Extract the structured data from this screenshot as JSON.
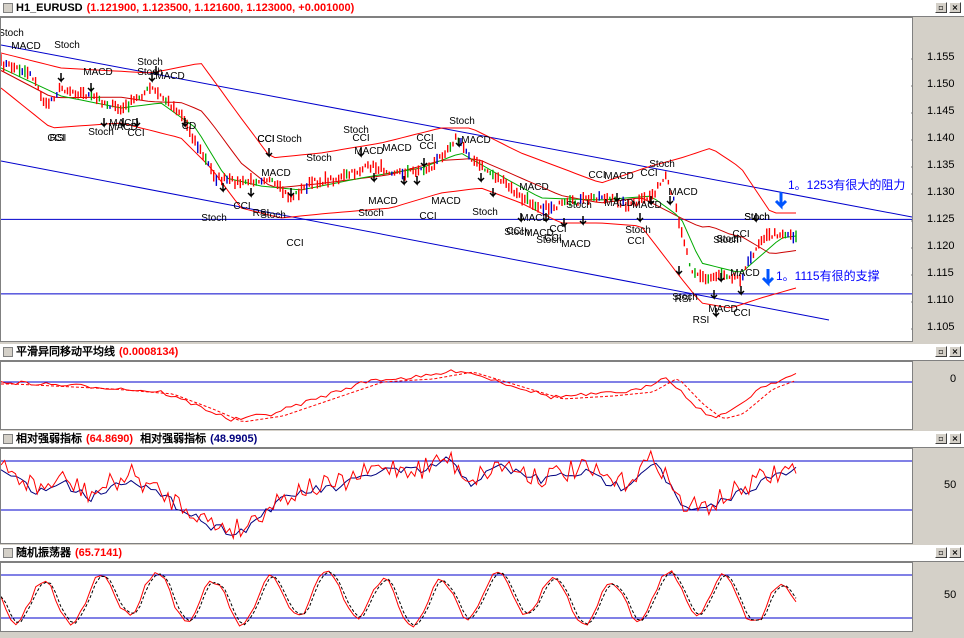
{
  "colors": {
    "price_red": "#ff0000",
    "trend_blue": "#0000cc",
    "ma_green": "#00aa00",
    "frame": "#808080",
    "annotation_blue": "#0000ff"
  },
  "main": {
    "title_symbol": "H1_EURUSD",
    "title_values": "(1.121900, 1.123500, 1.121600, 1.123000, +0.001000)",
    "y_ticks": [
      "1.155",
      "1.150",
      "1.145",
      "1.140",
      "1.135",
      "1.130",
      "1.125",
      "1.120",
      "1.115",
      "1.110",
      "1.105"
    ],
    "annotation_resistance": "1。1253有很大的阻力",
    "annotation_support": "1。1115有很的支撑"
  },
  "macd": {
    "title": "平滑异同移动平均线",
    "value": "(0.0008134)",
    "y_ticks": [
      "0"
    ]
  },
  "rsi": {
    "title1": "相对强弱指标",
    "value1": "(64.8690)",
    "title2": "相对强弱指标",
    "value2": "(48.9905)",
    "y_ticks": [
      "50"
    ]
  },
  "stoch": {
    "title": "随机振荡器",
    "value": "(65.7141)",
    "y_ticks": [
      "50"
    ]
  },
  "signals": [
    {
      "t": "Stoch"
    },
    {
      "t": "MACD"
    },
    {
      "t": "Stoch"
    },
    {
      "t": "MACD"
    },
    {
      "t": "Stoch"
    },
    {
      "t": "Stoch"
    },
    {
      "t": "MACD"
    },
    {
      "t": "CCI"
    },
    {
      "t": "RSI"
    },
    {
      "t": "MACD"
    },
    {
      "t": "Stoch"
    },
    {
      "t": "MACD"
    },
    {
      "t": "CCI"
    },
    {
      "t": "CD"
    },
    {
      "t": "CCI"
    },
    {
      "t": "CCI"
    },
    {
      "t": "Stoch"
    },
    {
      "t": "MACD"
    },
    {
      "t": "Stoch"
    },
    {
      "t": "Stoch"
    },
    {
      "t": "MACD"
    },
    {
      "t": "CCI"
    },
    {
      "t": "RSI"
    },
    {
      "t": "Stoch"
    },
    {
      "t": "CCI"
    },
    {
      "t": "Stoch"
    },
    {
      "t": "CCI"
    },
    {
      "t": "MACD"
    },
    {
      "t": "Stoch"
    },
    {
      "t": "CCI"
    },
    {
      "t": "MACD"
    },
    {
      "t": "CCI"
    },
    {
      "t": "MACD"
    },
    {
      "t": "CCI"
    },
    {
      "t": "Stoch"
    },
    {
      "t": "MACD"
    },
    {
      "t": "Stoch"
    },
    {
      "t": "CCI"
    },
    {
      "t": "MACD"
    },
    {
      "t": "Stoch"
    },
    {
      "t": "MACD"
    },
    {
      "t": "CCI"
    },
    {
      "t": "Stoch"
    },
    {
      "t": "CCI"
    },
    {
      "t": "MACD"
    },
    {
      "t": "Stoch"
    },
    {
      "t": "CCI"
    },
    {
      "t": "MACD"
    },
    {
      "t": "MACD"
    },
    {
      "t": "Stoch"
    },
    {
      "t": "CCI"
    },
    {
      "t": "MACD"
    },
    {
      "t": "Stoch"
    },
    {
      "t": "CCI"
    },
    {
      "t": "Stoch"
    },
    {
      "t": "MACD"
    },
    {
      "t": "CCI"
    },
    {
      "t": "Stoch"
    },
    {
      "t": "RSI"
    },
    {
      "t": "RSI"
    },
    {
      "t": "MACD"
    },
    {
      "t": "CCI"
    },
    {
      "t": "Stoch"
    },
    {
      "t": "Stoch"
    },
    {
      "t": "MACD"
    },
    {
      "t": "Stoch"
    },
    {
      "t": "MACD"
    }
  ]
}
